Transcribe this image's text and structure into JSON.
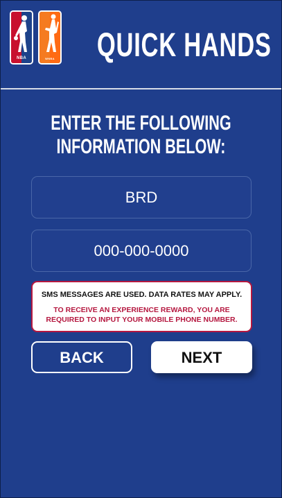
{
  "header": {
    "title": "QUICK HANDS",
    "logos": [
      {
        "icon": "nba-logo-icon",
        "label": "NBA",
        "colors": [
          "#c8102e",
          "#1d428a"
        ]
      },
      {
        "icon": "wnba-logo-icon",
        "label": "WNBA",
        "colors": [
          "#f57b20",
          "#ff6a13"
        ]
      }
    ]
  },
  "form": {
    "instructions": "ENTER THE FOLLOWING INFORMATION BELOW:",
    "initials_value": "BRD",
    "phone_placeholder": "000-000-0000"
  },
  "notice": {
    "line1": "SMS MESSAGES ARE USED. DATA RATES MAY APPLY.",
    "line2": "TO RECEIVE AN EXPERIENCE REWARD, YOU ARE REQUIRED TO INPUT YOUR MOBILE PHONE NUMBER."
  },
  "buttons": {
    "back_label": "BACK",
    "next_label": "NEXT"
  },
  "colors": {
    "background": "#1f3e8c",
    "notice_accent": "#b5173f"
  }
}
